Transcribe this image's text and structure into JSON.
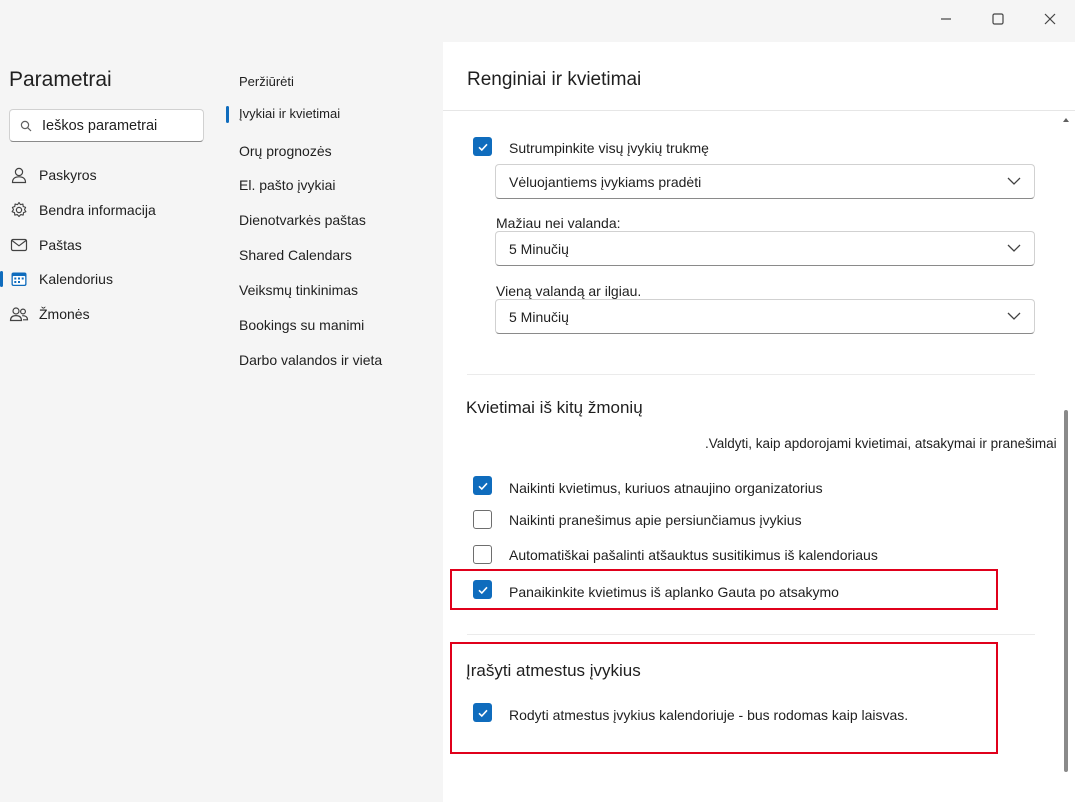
{
  "window": {
    "minimize_icon": "minimize-icon",
    "maximize_icon": "maximize-icon",
    "close_icon": "close-icon"
  },
  "nav": {
    "title": "Parametrai",
    "search_placeholder": "Ieškos parametrai",
    "items": [
      {
        "label": "Paskyros",
        "icon": "person-icon"
      },
      {
        "label": "Bendra informacija",
        "icon": "gear-icon"
      },
      {
        "label": "Paštas",
        "icon": "mail-icon"
      },
      {
        "label": "Kalendorius",
        "icon": "calendar-icon",
        "selected": true
      },
      {
        "label": "Žmonės",
        "icon": "people-icon"
      }
    ]
  },
  "subnav": {
    "items": [
      {
        "label": "Peržiūrėti"
      },
      {
        "label": "Įvykiai ir kvietimai",
        "selected": true
      },
      {
        "label": "Orų prognozės"
      },
      {
        "label": "El. pašto įvykiai"
      },
      {
        "label": "Dienotvarkės paštas"
      },
      {
        "label": "Shared Calendars"
      },
      {
        "label": "Veiksmų tinkinimas"
      },
      {
        "label": "Bookings su manimi"
      },
      {
        "label": "Darbo valandos ir vieta"
      }
    ]
  },
  "content": {
    "title": "Renginiai ir kvietimai",
    "shorten": {
      "checkbox_label": "Sutrumpinkite visų įvykių trukmę",
      "checked": true,
      "mode_value": "Vėluojantiems įvykiams pradėti",
      "less_than_hour_label": "Mažiau nei valanda:",
      "less_than_hour_value": "5 Minučių",
      "hour_or_more_label": "Vieną valandą ar ilgiau.",
      "hour_or_more_value": "5 Minučių"
    },
    "invites": {
      "title": "Kvietimai iš kitų žmonių",
      "description": ".Valdyti, kaip apdorojami kvietimai, atsakymai ir pranešimai",
      "options": [
        {
          "label": "Naikinti kvietimus, kuriuos atnaujino organizatorius",
          "checked": true
        },
        {
          "label": "Naikinti pranešimus apie persiunčiamus įvykius",
          "checked": false
        },
        {
          "label": "Automatiškai pašalinti atšauktus susitikimus iš kalendoriaus",
          "checked": false
        },
        {
          "label": "Panaikinkite kvietimus iš aplanko Gauta po atsakymo",
          "checked": true
        }
      ]
    },
    "declined": {
      "title": "Įrašyti atmestus įvykius",
      "option_label": "Rodyti atmestus įvykius kalendoriuje - bus rodomas kaip laisvas.",
      "checked": true
    }
  },
  "colors": {
    "accent": "#0f6cbd",
    "highlight": "#e0001b",
    "pane_bg": "#f5f5f5"
  }
}
